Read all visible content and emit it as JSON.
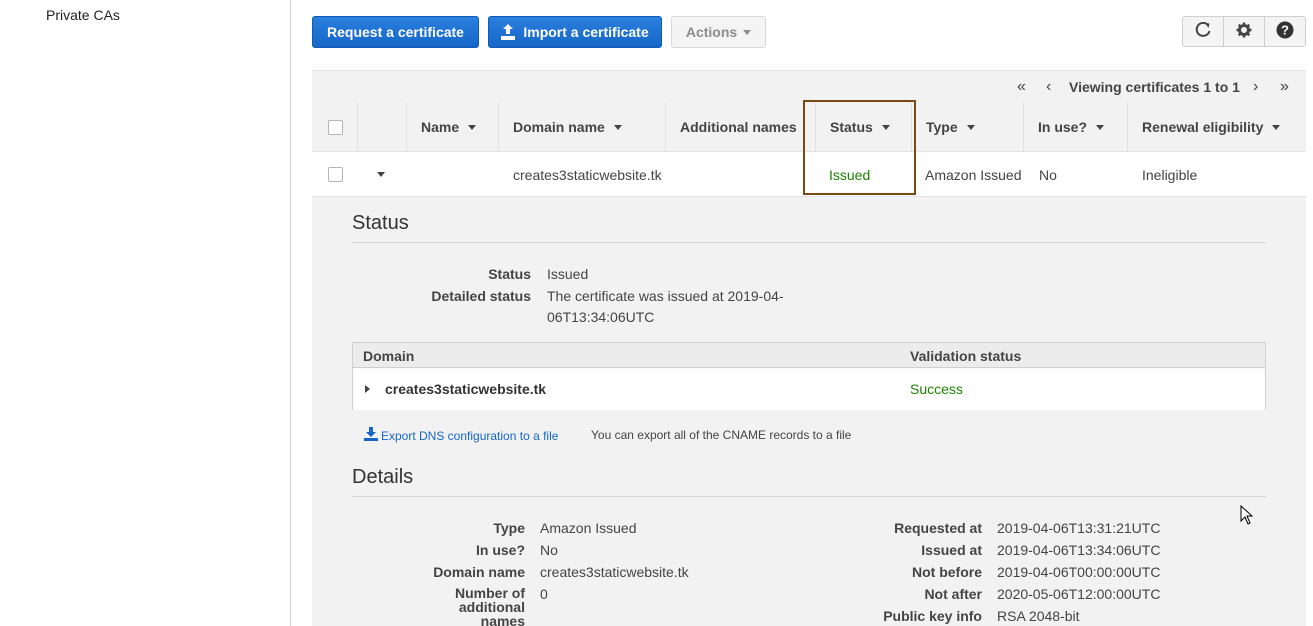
{
  "sidebar": {
    "items": [
      "Private CAs"
    ]
  },
  "toolbar": {
    "request_label": "Request a certificate",
    "import_label": "Import a certificate",
    "actions_label": "Actions"
  },
  "icons": {
    "refresh": "refresh-icon",
    "settings": "gear-icon",
    "help": "help-icon",
    "upload": "upload-icon",
    "download": "download-icon"
  },
  "pager": {
    "text": "Viewing certificates 1 to 1"
  },
  "table": {
    "columns": [
      "Name",
      "Domain name",
      "Additional names",
      "Status",
      "Type",
      "In use?",
      "Renewal eligibility"
    ],
    "rows": [
      {
        "name": "",
        "domain": "creates3staticwebsite.tk",
        "additional": "",
        "status": "Issued",
        "type": "Amazon Issued",
        "in_use": "No",
        "renewal": "Ineligible"
      }
    ]
  },
  "status_section": {
    "title": "Status",
    "status_label": "Status",
    "status_value": "Issued",
    "detailed_label": "Detailed status",
    "detailed_value_line1": "The certificate was issued at 2019-04-",
    "detailed_value_line2": "06T13:34:06UTC"
  },
  "domain_table": {
    "col_domain": "Domain",
    "col_validation": "Validation status",
    "rows": [
      {
        "domain": "creates3staticwebsite.tk",
        "validation": "Success"
      }
    ]
  },
  "export": {
    "link": "Export DNS configuration to a file",
    "note": "You can export all of the CNAME records to a file"
  },
  "details_section": {
    "title": "Details",
    "left": [
      {
        "label": "Type",
        "value": "Amazon Issued"
      },
      {
        "label": "In use?",
        "value": "No"
      },
      {
        "label": "Domain name",
        "value": "creates3staticwebsite.tk"
      },
      {
        "label": "Number of additional names",
        "value": "0"
      }
    ],
    "right": [
      {
        "label": "Requested at",
        "value": "2019-04-06T13:31:21UTC"
      },
      {
        "label": "Issued at",
        "value": "2019-04-06T13:34:06UTC"
      },
      {
        "label": "Not before",
        "value": "2019-04-06T00:00:00UTC"
      },
      {
        "label": "Not after",
        "value": "2020-05-06T12:00:00UTC"
      },
      {
        "label": "Public key info",
        "value": "RSA 2048-bit"
      }
    ]
  },
  "colors": {
    "primary": "#1a73d9",
    "success": "#1d8102",
    "highlight": "#7a4a13",
    "panel_bg": "#f2f2f2"
  }
}
